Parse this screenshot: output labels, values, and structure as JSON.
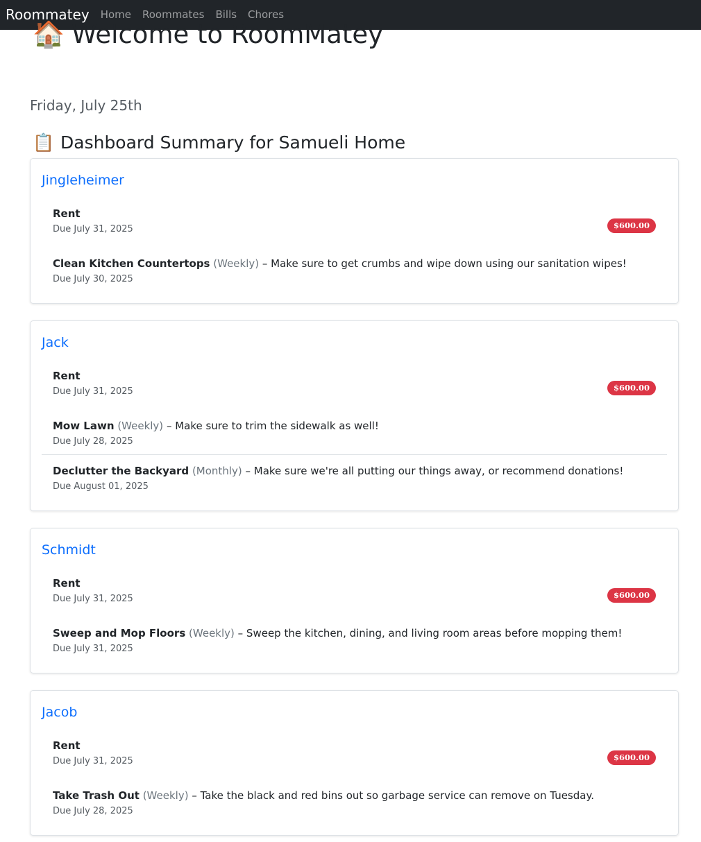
{
  "nav": {
    "brand": "Roommatey",
    "links": [
      "Home",
      "Roommates",
      "Bills",
      "Chores"
    ]
  },
  "page": {
    "title_emoji": "🏠",
    "title": "Welcome to RoomMatey",
    "date": "Friday, July 25th",
    "summary_emoji": "📋",
    "summary_title": "Dashboard Summary for Samueli Home"
  },
  "cards": [
    {
      "name": "Jingleheimer",
      "bill": {
        "title": "Rent",
        "due": "Due July 31, 2025",
        "amount": "$600.00"
      },
      "chores": [
        {
          "title": "Clean Kitchen Countertops",
          "frequency": "(Weekly)",
          "desc": " – Make sure to get crumbs and wipe down using our sanitation wipes!",
          "due": "Due July 30, 2025"
        }
      ]
    },
    {
      "name": "Jack",
      "bill": {
        "title": "Rent",
        "due": "Due July 31, 2025",
        "amount": "$600.00"
      },
      "chores": [
        {
          "title": "Mow Lawn",
          "frequency": "(Weekly)",
          "desc": " – Make sure to trim the sidewalk as well!",
          "due": "Due July 28, 2025"
        },
        {
          "title": "Declutter the Backyard",
          "frequency": "(Monthly)",
          "desc": " – Make sure we're all putting our things away, or recommend donations!",
          "due": "Due August 01, 2025"
        }
      ]
    },
    {
      "name": "Schmidt",
      "bill": {
        "title": "Rent",
        "due": "Due July 31, 2025",
        "amount": "$600.00"
      },
      "chores": [
        {
          "title": "Sweep and Mop Floors",
          "frequency": "(Weekly)",
          "desc": " – Sweep the kitchen, dining, and living room areas before mopping them!",
          "due": "Due July 31, 2025"
        }
      ]
    },
    {
      "name": "Jacob",
      "bill": {
        "title": "Rent",
        "due": "Due July 31, 2025",
        "amount": "$600.00"
      },
      "chores": [
        {
          "title": "Take Trash Out",
          "frequency": "(Weekly)",
          "desc": " – Take the black and red bins out so garbage service can remove on Tuesday.",
          "due": "Due July 28, 2025"
        }
      ]
    }
  ]
}
